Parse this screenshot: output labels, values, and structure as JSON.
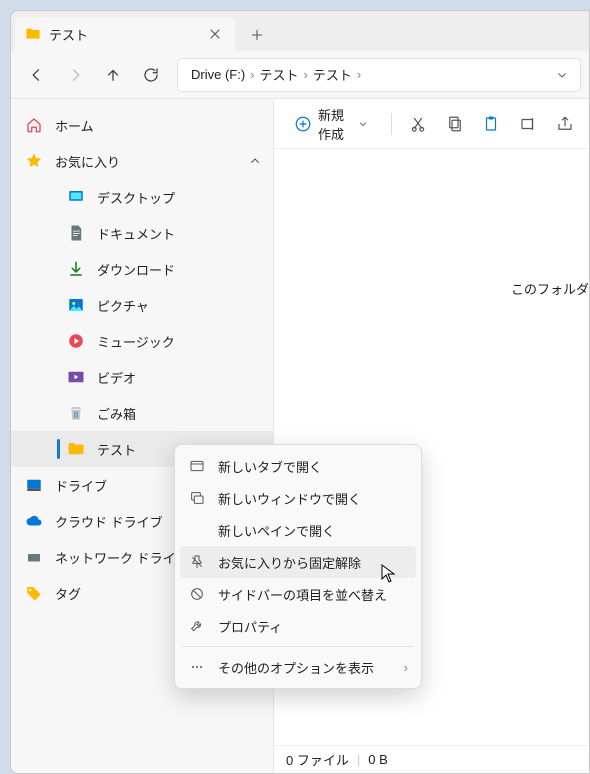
{
  "tab": {
    "title": "テスト"
  },
  "breadcrumb": [
    "Drive (F:)",
    "テスト",
    "テスト"
  ],
  "toolbar": {
    "new_label": "新規作成"
  },
  "sidebar": {
    "home": "ホーム",
    "favorites": "お気に入り",
    "fav_items": [
      "デスクトップ",
      "ドキュメント",
      "ダウンロード",
      "ピクチャ",
      "ミュージック",
      "ビデオ",
      "ごみ箱",
      "テスト"
    ],
    "drive": "ドライブ",
    "cloud": "クラウド ドライブ",
    "network": "ネットワーク ドライブ",
    "tag": "タグ"
  },
  "content": {
    "empty": "このフォルダ"
  },
  "status": {
    "count": "0 ファイル",
    "size": "0 B"
  },
  "menu": {
    "open_tab": "新しいタブで開く",
    "open_window": "新しいウィンドウで開く",
    "open_pane": "新しいペインで開く",
    "unpin": "お気に入りから固定解除",
    "reorder": "サイドバーの項目を並べ替え",
    "properties": "プロパティ",
    "more": "その他のオプションを表示"
  }
}
